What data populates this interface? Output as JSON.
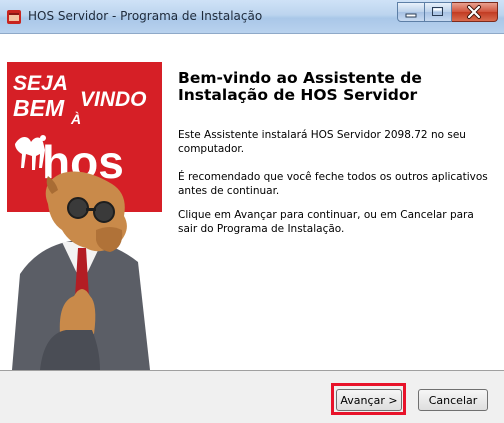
{
  "window": {
    "title": "HOS Servidor - Programa de Instalação"
  },
  "banner": {
    "line1": "SEJA",
    "line2": "BEM",
    "line3": "VINDO",
    "letter_a": "À",
    "brand": "hos"
  },
  "main": {
    "heading": "Bem-vindo ao Assistente de Instalação de HOS Servidor",
    "paragraphs": [
      "Este Assistente instalará HOS Servidor 2098.72 no seu computador.",
      "É recomendado que você feche todos os outros aplicativos antes de continuar.",
      "Clique em Avançar para continuar, ou em Cancelar para sair do Programa de Instalação."
    ]
  },
  "buttons": {
    "next": "Avançar >",
    "cancel": "Cancelar"
  },
  "colors": {
    "banner_red": "#d61f26",
    "highlight": "#e8132a"
  }
}
